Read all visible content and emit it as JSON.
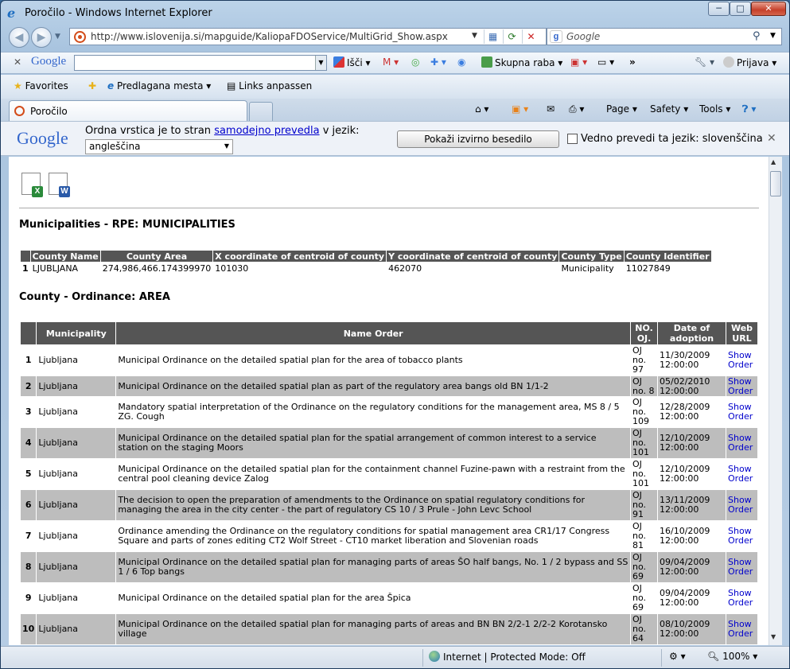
{
  "window": {
    "title": "Poročilo - Windows Internet Explorer",
    "min": "─",
    "max": "□",
    "close": "✕"
  },
  "address": {
    "url": "http://www.islovenija.si/mapguide/KaliopaFDOService/MultiGrid_Show.aspx"
  },
  "search": {
    "placeholder": "Google"
  },
  "google_toolbar": {
    "logo": "Google",
    "search_label": "Išči",
    "share_label": "Skupna raba",
    "signin_label": "Prijava"
  },
  "favorites_bar": {
    "favorites": "Favorites",
    "suggested": "Predlagana mesta",
    "links": "Links anpassen"
  },
  "tab": {
    "label": "Poročilo"
  },
  "command_bar": {
    "page": "Page",
    "safety": "Safety",
    "tools": "Tools"
  },
  "translate_bar": {
    "logo": "Google",
    "msg_before": "Ordna vrstica je to stran ",
    "msg_link": "samodejno prevedla",
    "msg_after": " v jezik:",
    "language": "angleščina",
    "show_original": "Pokaži izvirno besedilo",
    "always": "Vedno prevedi ta jezik: slovenščina"
  },
  "export": {
    "excel": "X",
    "word": "W"
  },
  "section1": {
    "title": "Municipalities - RPE: MUNICIPALITIES",
    "headers": [
      "County Name",
      "County Area",
      "X coordinate of centroid of county",
      "Y coordinate of centroid of county",
      "County Type",
      "County Identifier"
    ],
    "rows": [
      [
        "1",
        "LJUBLJANA",
        "274,986,466.174399970",
        "101030",
        "462070",
        "Municipality",
        "11027849"
      ]
    ]
  },
  "section2": {
    "title": "County - Ordinance: AREA",
    "headers": [
      "Municipality",
      "Name Order",
      "NO. OJ.",
      "Date of adoption",
      "Web URL"
    ],
    "link_text": "Show Order",
    "rows": [
      {
        "n": "1",
        "m": "Ljubljana",
        "name": "Municipal Ordinance on the detailed spatial plan for the area of tobacco plants",
        "oj": "OJ no. 97",
        "date": "11/30/2009 12:00:00"
      },
      {
        "n": "2",
        "m": "Ljubljana",
        "name": "Municipal Ordinance on the detailed spatial plan as part of the regulatory area bangs old BN 1/1-2",
        "oj": "OJ no. 8",
        "date": "05/02/2010 12:00:00"
      },
      {
        "n": "3",
        "m": "Ljubljana",
        "name": "Mandatory spatial interpretation of the Ordinance on the regulatory conditions for the management area, MS 8 / 5 ZG. Cough",
        "oj": "OJ no. 109",
        "date": "12/28/2009 12:00:00"
      },
      {
        "n": "4",
        "m": "Ljubljana",
        "name": "Municipal Ordinance on the detailed spatial plan for the spatial arrangement of common interest to a service station on the staging Moors",
        "oj": "OJ no. 101",
        "date": "12/10/2009 12:00:00"
      },
      {
        "n": "5",
        "m": "Ljubljana",
        "name": "Municipal Ordinance on the detailed spatial plan for the containment channel Fuzine-pawn with a restraint from the central pool cleaning device Zalog",
        "oj": "OJ no. 101",
        "date": "12/10/2009 12:00:00"
      },
      {
        "n": "6",
        "m": "Ljubljana",
        "name": "The decision to open the preparation of amendments to the Ordinance on spatial regulatory conditions for managing the area in the city center - the part of regulatory CS 10 / 3 Prule - John Levc School",
        "oj": "OJ no. 91",
        "date": "13/11/2009 12:00:00"
      },
      {
        "n": "7",
        "m": "Ljubljana",
        "name": "Ordinance amending the Ordinance on the regulatory conditions for spatial management area CR1/17 Congress Square and parts of zones editing CT2 Wolf Street - CT10 market liberation and Slovenian roads",
        "oj": "OJ no. 81",
        "date": "16/10/2009 12:00:00"
      },
      {
        "n": "8",
        "m": "Ljubljana",
        "name": "Municipal Ordinance on the detailed spatial plan for managing parts of areas ŠO half bangs, No. 1 / 2 bypass and SS 1 / 6 Top bangs",
        "oj": "OJ no. 69",
        "date": "09/04/2009 12:00:00"
      },
      {
        "n": "9",
        "m": "Ljubljana",
        "name": "Municipal Ordinance on the detailed spatial plan for the area Špica",
        "oj": "OJ no. 69",
        "date": "09/04/2009 12:00:00"
      },
      {
        "n": "10",
        "m": "Ljubljana",
        "name": "Municipal Ordinance on the detailed spatial plan for managing parts of areas and BN BN 2/2-1 2/2-2 Korotansko village",
        "oj": "OJ no. 64",
        "date": "08/10/2009 12:00:00"
      }
    ]
  },
  "status": {
    "zone": "Internet | Protected Mode: Off",
    "zoom": "100%"
  }
}
